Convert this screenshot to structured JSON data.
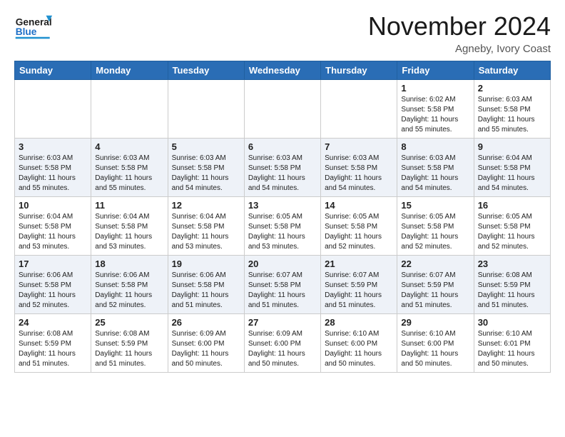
{
  "header": {
    "logo_line1": "General",
    "logo_line2": "Blue",
    "month": "November 2024",
    "location": "Agneby, Ivory Coast"
  },
  "days_of_week": [
    "Sunday",
    "Monday",
    "Tuesday",
    "Wednesday",
    "Thursday",
    "Friday",
    "Saturday"
  ],
  "weeks": [
    [
      {
        "day": "",
        "info": ""
      },
      {
        "day": "",
        "info": ""
      },
      {
        "day": "",
        "info": ""
      },
      {
        "day": "",
        "info": ""
      },
      {
        "day": "",
        "info": ""
      },
      {
        "day": "1",
        "info": "Sunrise: 6:02 AM\nSunset: 5:58 PM\nDaylight: 11 hours\nand 55 minutes."
      },
      {
        "day": "2",
        "info": "Sunrise: 6:03 AM\nSunset: 5:58 PM\nDaylight: 11 hours\nand 55 minutes."
      }
    ],
    [
      {
        "day": "3",
        "info": "Sunrise: 6:03 AM\nSunset: 5:58 PM\nDaylight: 11 hours\nand 55 minutes."
      },
      {
        "day": "4",
        "info": "Sunrise: 6:03 AM\nSunset: 5:58 PM\nDaylight: 11 hours\nand 55 minutes."
      },
      {
        "day": "5",
        "info": "Sunrise: 6:03 AM\nSunset: 5:58 PM\nDaylight: 11 hours\nand 54 minutes."
      },
      {
        "day": "6",
        "info": "Sunrise: 6:03 AM\nSunset: 5:58 PM\nDaylight: 11 hours\nand 54 minutes."
      },
      {
        "day": "7",
        "info": "Sunrise: 6:03 AM\nSunset: 5:58 PM\nDaylight: 11 hours\nand 54 minutes."
      },
      {
        "day": "8",
        "info": "Sunrise: 6:03 AM\nSunset: 5:58 PM\nDaylight: 11 hours\nand 54 minutes."
      },
      {
        "day": "9",
        "info": "Sunrise: 6:04 AM\nSunset: 5:58 PM\nDaylight: 11 hours\nand 54 minutes."
      }
    ],
    [
      {
        "day": "10",
        "info": "Sunrise: 6:04 AM\nSunset: 5:58 PM\nDaylight: 11 hours\nand 53 minutes."
      },
      {
        "day": "11",
        "info": "Sunrise: 6:04 AM\nSunset: 5:58 PM\nDaylight: 11 hours\nand 53 minutes."
      },
      {
        "day": "12",
        "info": "Sunrise: 6:04 AM\nSunset: 5:58 PM\nDaylight: 11 hours\nand 53 minutes."
      },
      {
        "day": "13",
        "info": "Sunrise: 6:05 AM\nSunset: 5:58 PM\nDaylight: 11 hours\nand 53 minutes."
      },
      {
        "day": "14",
        "info": "Sunrise: 6:05 AM\nSunset: 5:58 PM\nDaylight: 11 hours\nand 52 minutes."
      },
      {
        "day": "15",
        "info": "Sunrise: 6:05 AM\nSunset: 5:58 PM\nDaylight: 11 hours\nand 52 minutes."
      },
      {
        "day": "16",
        "info": "Sunrise: 6:05 AM\nSunset: 5:58 PM\nDaylight: 11 hours\nand 52 minutes."
      }
    ],
    [
      {
        "day": "17",
        "info": "Sunrise: 6:06 AM\nSunset: 5:58 PM\nDaylight: 11 hours\nand 52 minutes."
      },
      {
        "day": "18",
        "info": "Sunrise: 6:06 AM\nSunset: 5:58 PM\nDaylight: 11 hours\nand 52 minutes."
      },
      {
        "day": "19",
        "info": "Sunrise: 6:06 AM\nSunset: 5:58 PM\nDaylight: 11 hours\nand 51 minutes."
      },
      {
        "day": "20",
        "info": "Sunrise: 6:07 AM\nSunset: 5:58 PM\nDaylight: 11 hours\nand 51 minutes."
      },
      {
        "day": "21",
        "info": "Sunrise: 6:07 AM\nSunset: 5:59 PM\nDaylight: 11 hours\nand 51 minutes."
      },
      {
        "day": "22",
        "info": "Sunrise: 6:07 AM\nSunset: 5:59 PM\nDaylight: 11 hours\nand 51 minutes."
      },
      {
        "day": "23",
        "info": "Sunrise: 6:08 AM\nSunset: 5:59 PM\nDaylight: 11 hours\nand 51 minutes."
      }
    ],
    [
      {
        "day": "24",
        "info": "Sunrise: 6:08 AM\nSunset: 5:59 PM\nDaylight: 11 hours\nand 51 minutes."
      },
      {
        "day": "25",
        "info": "Sunrise: 6:08 AM\nSunset: 5:59 PM\nDaylight: 11 hours\nand 51 minutes."
      },
      {
        "day": "26",
        "info": "Sunrise: 6:09 AM\nSunset: 6:00 PM\nDaylight: 11 hours\nand 50 minutes."
      },
      {
        "day": "27",
        "info": "Sunrise: 6:09 AM\nSunset: 6:00 PM\nDaylight: 11 hours\nand 50 minutes."
      },
      {
        "day": "28",
        "info": "Sunrise: 6:10 AM\nSunset: 6:00 PM\nDaylight: 11 hours\nand 50 minutes."
      },
      {
        "day": "29",
        "info": "Sunrise: 6:10 AM\nSunset: 6:00 PM\nDaylight: 11 hours\nand 50 minutes."
      },
      {
        "day": "30",
        "info": "Sunrise: 6:10 AM\nSunset: 6:01 PM\nDaylight: 11 hours\nand 50 minutes."
      }
    ]
  ]
}
